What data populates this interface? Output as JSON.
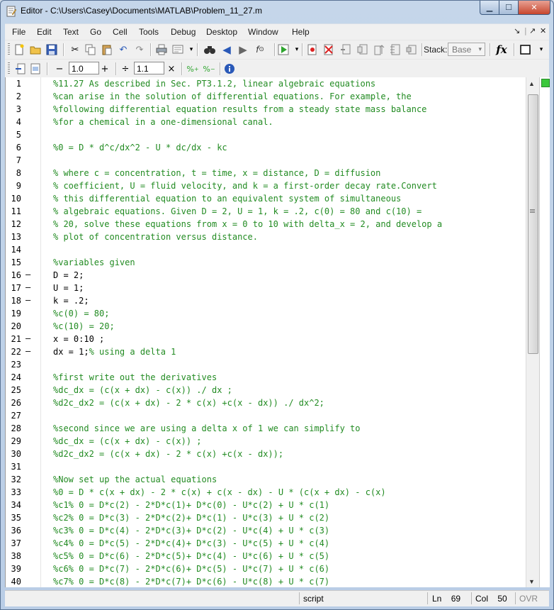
{
  "window": {
    "title": "Editor - C:\\Users\\Casey\\Documents\\MATLAB\\Problem_11_27.m"
  },
  "menubar": {
    "items": [
      "File",
      "Edit",
      "Text",
      "Go",
      "Cell",
      "Tools",
      "Debug",
      "Desktop",
      "Window",
      "Help"
    ]
  },
  "toolbar": {
    "stack_label": "Stack:",
    "stack_value": "Base",
    "fx_label": "fx",
    "cell_minus": "−",
    "cell_value_1": "1.0",
    "cell_plus": "+",
    "cell_divide": "÷",
    "cell_value_2": "1.1",
    "cell_times": "×"
  },
  "editor": {
    "lines": [
      {
        "n": "1",
        "bp": "",
        "code": "%11.27 As described in Sec. PT3.1.2, linear algebraic equations",
        "comment": true
      },
      {
        "n": "2",
        "bp": "",
        "code": "%can arise in the solution of differential equations. For example, the",
        "comment": true
      },
      {
        "n": "3",
        "bp": "",
        "code": "%following differential equation results from a steady state mass balance",
        "comment": true
      },
      {
        "n": "4",
        "bp": "",
        "code": "%for a chemical in a one-dimensional canal.",
        "comment": true
      },
      {
        "n": "5",
        "bp": "",
        "code": "",
        "comment": true
      },
      {
        "n": "6",
        "bp": "",
        "code": "%0 = D * d^c/dx^2 - U * dc/dx - kc",
        "comment": true
      },
      {
        "n": "7",
        "bp": "",
        "code": "",
        "comment": true
      },
      {
        "n": "8",
        "bp": "",
        "code": "% where c = concentration, t = time, x = distance, D = diffusion",
        "comment": true
      },
      {
        "n": "9",
        "bp": "",
        "code": "% coefficient, U = fluid velocity, and k = a first-order decay rate.Convert",
        "comment": true
      },
      {
        "n": "10",
        "bp": "",
        "code": "% this differential equation to an equivalent system of simultaneous",
        "comment": true
      },
      {
        "n": "11",
        "bp": "",
        "code": "% algebraic equations. Given D = 2, U = 1, k = .2, c(0) = 80 and c(10) =",
        "comment": true
      },
      {
        "n": "12",
        "bp": "",
        "code": "% 20, solve these equations from x = 0 to 10 with delta_x = 2, and develop a",
        "comment": true
      },
      {
        "n": "13",
        "bp": "",
        "code": "% plot of concentration versus distance.",
        "comment": true
      },
      {
        "n": "14",
        "bp": "",
        "code": "",
        "comment": true
      },
      {
        "n": "15",
        "bp": "",
        "code": "%variables given",
        "comment": true
      },
      {
        "n": "16",
        "bp": "–",
        "code": "D = 2;",
        "comment": false
      },
      {
        "n": "17",
        "bp": "–",
        "code": "U = 1;",
        "comment": false
      },
      {
        "n": "18",
        "bp": "–",
        "code": "k = .2;",
        "comment": false
      },
      {
        "n": "19",
        "bp": "",
        "code": "%c(0) = 80;",
        "comment": true
      },
      {
        "n": "20",
        "bp": "",
        "code": "%c(10) = 20;",
        "comment": true
      },
      {
        "n": "21",
        "bp": "–",
        "code": "x = 0:10 ;",
        "comment": false
      },
      {
        "n": "22",
        "bp": "–",
        "code": "dx = 1;",
        "inline": "% using a delta 1",
        "comment": false
      },
      {
        "n": "23",
        "bp": "",
        "code": "",
        "comment": true
      },
      {
        "n": "24",
        "bp": "",
        "code": "%first write out the derivatives",
        "comment": true
      },
      {
        "n": "25",
        "bp": "",
        "code": "%dc_dx = (c(x + dx) - c(x)) ./ dx ;",
        "comment": true
      },
      {
        "n": "26",
        "bp": "",
        "code": "%d2c_dx2 = (c(x + dx) - 2 * c(x) +c(x - dx)) ./ dx^2;",
        "comment": true
      },
      {
        "n": "27",
        "bp": "",
        "code": "",
        "comment": true
      },
      {
        "n": "28",
        "bp": "",
        "code": "%second since we are using a delta x of 1 we can simplify to",
        "comment": true
      },
      {
        "n": "29",
        "bp": "",
        "code": "%dc_dx = (c(x + dx) - c(x)) ;",
        "comment": true
      },
      {
        "n": "30",
        "bp": "",
        "code": "%d2c_dx2 = (c(x + dx) - 2 * c(x) +c(x - dx));",
        "comment": true
      },
      {
        "n": "31",
        "bp": "",
        "code": "",
        "comment": true
      },
      {
        "n": "32",
        "bp": "",
        "code": "%Now set up the actual equations",
        "comment": true
      },
      {
        "n": "33",
        "bp": "",
        "code": "%0 = D * c(x + dx) - 2 * c(x) + c(x - dx) - U * (c(x + dx) - c(x)",
        "comment": true
      },
      {
        "n": "34",
        "bp": "",
        "code": "%c1% 0 = D*c(2) - 2*D*c(1)+ D*c(0) - U*c(2) + U * c(1)",
        "comment": true
      },
      {
        "n": "35",
        "bp": "",
        "code": "%c2% 0 = D*c(3) - 2*D*c(2)+ D*c(1) - U*c(3) + U * c(2)",
        "comment": true
      },
      {
        "n": "36",
        "bp": "",
        "code": "%c3% 0 = D*c(4) - 2*D*c(3)+ D*c(2) - U*c(4) + U * c(3)",
        "comment": true
      },
      {
        "n": "37",
        "bp": "",
        "code": "%c4% 0 = D*c(5) - 2*D*c(4)+ D*c(3) - U*c(5) + U * c(4)",
        "comment": true
      },
      {
        "n": "38",
        "bp": "",
        "code": "%c5% 0 = D*c(6) - 2*D*c(5)+ D*c(4) - U*c(6) + U * c(5)",
        "comment": true
      },
      {
        "n": "39",
        "bp": "",
        "code": "%c6% 0 = D*c(7) - 2*D*c(6)+ D*c(5) - U*c(7) + U * c(6)",
        "comment": true
      },
      {
        "n": "40",
        "bp": "",
        "code": "%c7% 0 = D*c(8) - 2*D*c(7)+ D*c(6) - U*c(8) + U * c(7)",
        "comment": true
      }
    ]
  },
  "statusbar": {
    "mode": "script",
    "ln_label": "Ln",
    "ln_value": "69",
    "col_label": "Col",
    "col_value": "50",
    "ovr": "OVR"
  },
  "colors": {
    "comment": "#228b22",
    "code": "#000000"
  }
}
